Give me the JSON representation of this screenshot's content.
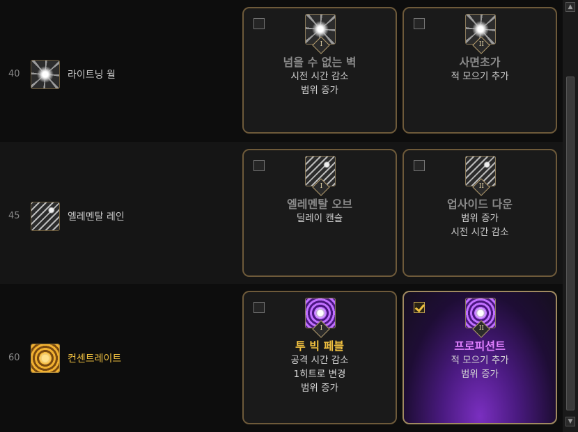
{
  "rows": [
    {
      "level": "40",
      "skill_name": "라이트닝 월",
      "skill_icon": "lightning-wall-icon",
      "cards": [
        {
          "roman": "I",
          "title": "넘을 수 없는 벽",
          "lines": [
            "시전 시간 감소",
            "범위 증가"
          ],
          "checked": false
        },
        {
          "roman": "II",
          "title": "사면초가",
          "lines": [
            "적 모으기 추가"
          ],
          "checked": false
        }
      ]
    },
    {
      "level": "45",
      "skill_name": "엘레멘탈 레인",
      "skill_icon": "elemental-rain-icon",
      "cards": [
        {
          "roman": "I",
          "title": "엘레멘탈 오브",
          "lines": [
            "딜레이 캔슬"
          ],
          "checked": false
        },
        {
          "roman": "II",
          "title": "업사이드 다운",
          "lines": [
            "범위 증가",
            "시전 시간 감소"
          ],
          "checked": false
        }
      ]
    },
    {
      "level": "60",
      "skill_name": "컨센트레이트",
      "skill_icon": "concentrate-icon",
      "cards": [
        {
          "roman": "I",
          "title": "투 빅 페블",
          "lines": [
            "공격 시간 감소",
            "1히트로 변경",
            "범위 증가"
          ],
          "checked": false
        },
        {
          "roman": "II",
          "title": "프로피션트",
          "lines": [
            "적 모으기 추가",
            "범위 증가"
          ],
          "checked": true
        }
      ]
    }
  ],
  "colors": {
    "gold": "#f0c040",
    "purple": "#e080ff",
    "border": "#6e5a3a"
  },
  "scrollbar": {
    "up": "▲",
    "down": "▼"
  }
}
